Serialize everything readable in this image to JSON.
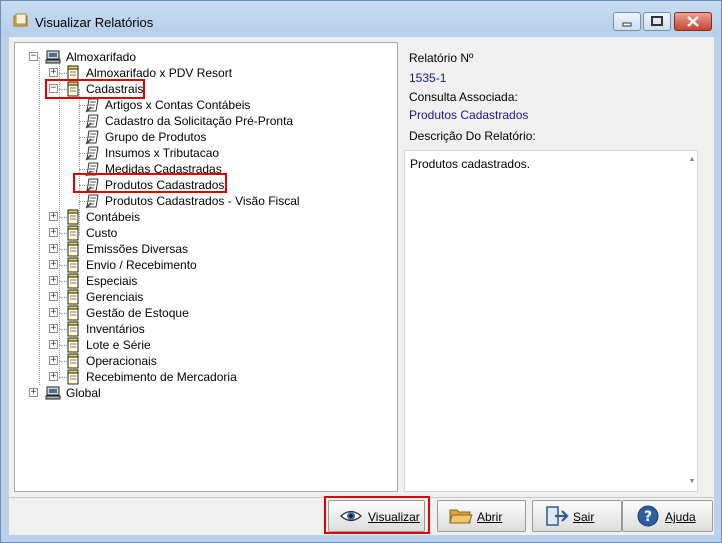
{
  "window": {
    "title": "Visualizar Relatórios"
  },
  "tree": {
    "root": "Almoxarifado",
    "children": [
      "Almoxarifado x PDV Resort",
      "Cadastrais",
      "Contábeis",
      "Custo",
      "Emissões Diversas",
      "Envio / Recebimento",
      "Especiais",
      "Gerenciais",
      "Gestão de Estoque",
      "Inventários",
      "Lote e Série",
      "Operacionais",
      "Recebimento de Mercadoria"
    ],
    "cadastrais_reports": [
      "Artigos x Contas Contábeis",
      "Cadastro da Solicitação Pré-Pronta",
      "Grupo de Produtos",
      "Insumos x Tributacao",
      "Medidas Cadastradas",
      "Produtos Cadastrados",
      "Produtos Cadastrados - Visão Fiscal"
    ],
    "root2": "Global"
  },
  "details": {
    "report_no_label": "Relatório Nº",
    "report_no": "1535-1",
    "query_label": "Consulta Associada:",
    "query": "Produtos Cadastrados",
    "desc_label": "Descrição Do Relatório:",
    "desc": "Produtos cadastrados."
  },
  "buttons": {
    "view": "Visualizar",
    "open": "Abrir",
    "exit": "Sair",
    "help": "Ajuda"
  },
  "colors": {
    "highlight": "#e00000",
    "link": "#1a1a80"
  }
}
